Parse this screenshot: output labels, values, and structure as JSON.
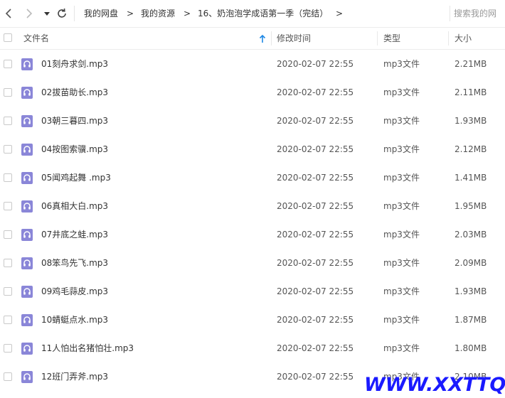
{
  "toolbar": {
    "breadcrumb": [
      "我的网盘",
      "我的资源",
      "16、奶泡泡学成语第一季（完结）"
    ],
    "separator": ">",
    "search_placeholder": "搜索我的网"
  },
  "columns": {
    "name": "文件名",
    "time": "修改时间",
    "type": "类型",
    "size": "大小"
  },
  "files": [
    {
      "name": "01刻舟求剑.mp3",
      "time": "2020-02-07 22:55",
      "type": "mp3文件",
      "size": "2.21MB"
    },
    {
      "name": "02拔苗助长.mp3",
      "time": "2020-02-07 22:55",
      "type": "mp3文件",
      "size": "2.11MB"
    },
    {
      "name": "03朝三暮四.mp3",
      "time": "2020-02-07 22:55",
      "type": "mp3文件",
      "size": "1.93MB"
    },
    {
      "name": "04按图索骥.mp3",
      "time": "2020-02-07 22:55",
      "type": "mp3文件",
      "size": "2.12MB"
    },
    {
      "name": "05闻鸡起舞 .mp3",
      "time": "2020-02-07 22:55",
      "type": "mp3文件",
      "size": "1.41MB"
    },
    {
      "name": "06真相大白.mp3",
      "time": "2020-02-07 22:55",
      "type": "mp3文件",
      "size": "1.95MB"
    },
    {
      "name": "07井底之蛙.mp3",
      "time": "2020-02-07 22:55",
      "type": "mp3文件",
      "size": "2.03MB"
    },
    {
      "name": "08笨鸟先飞.mp3",
      "time": "2020-02-07 22:55",
      "type": "mp3文件",
      "size": "2.09MB"
    },
    {
      "name": "09鸡毛蒜皮.mp3",
      "time": "2020-02-07 22:55",
      "type": "mp3文件",
      "size": "1.93MB"
    },
    {
      "name": "10蜻蜓点水.mp3",
      "time": "2020-02-07 22:55",
      "type": "mp3文件",
      "size": "1.87MB"
    },
    {
      "name": "11人怕出名猪怕壮.mp3",
      "time": "2020-02-07 22:55",
      "type": "mp3文件",
      "size": "1.80MB"
    },
    {
      "name": "12班门弄斧.mp3",
      "time": "2020-02-07 22:55",
      "type": "mp3文件",
      "size": "2.10MB"
    }
  ],
  "watermark": "WWW.XXTTQ.COM",
  "colors": {
    "file_icon": "#8a86d8",
    "sort_arrow": "#1e88e5",
    "watermark": "#1a1aff"
  },
  "icons": {
    "back": "chevron-left-icon",
    "forward": "chevron-right-icon",
    "dropdown": "caret-down-icon",
    "refresh": "refresh-icon",
    "file": "headphones-icon",
    "sort": "arrow-up-icon"
  }
}
